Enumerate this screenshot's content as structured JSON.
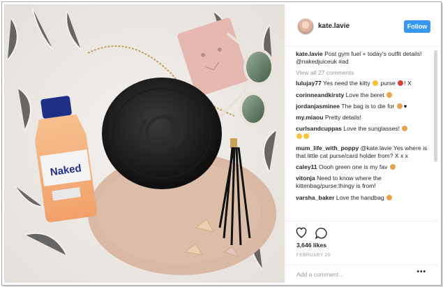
{
  "post": {
    "username": "kate.lavie",
    "follow_label": "Follow",
    "caption": {
      "user": "kate.lavie",
      "text": "Post gym fuel + today's outfit details! @nakedjuiceuk #ad"
    },
    "view_all_label": "View all 27 comments",
    "comments": [
      {
        "user": "lulujay77",
        "text": "Yes need the kitty",
        "trail": "purse",
        "end": "! X"
      },
      {
        "user": "corinneandkirsty",
        "text": "Love the beret",
        "trail": "",
        "end": ""
      },
      {
        "user": "jordanjasminee",
        "text": "The bag is to die for",
        "trail": "",
        "end": ""
      },
      {
        "user": "my.miaou",
        "text": "Pretty details!",
        "trail": "",
        "end": ""
      },
      {
        "user": "curlsandcuppas",
        "text": "Love the sunglasses!",
        "trail": "",
        "end": ""
      },
      {
        "user": "mum_life_with_poppy",
        "text": "@kate.lavie Yes where is that little cat purse/card holder from? X x x",
        "trail": "",
        "end": ""
      },
      {
        "user": "caley11",
        "text": "Oooh green one is my fav",
        "trail": "",
        "end": ""
      },
      {
        "user": "vitonja",
        "text": "Need to know where the kittenbag/purse:thingy is from!",
        "trail": "",
        "end": ""
      },
      {
        "user": "varsha_baker",
        "text": "Love the handbag",
        "trail": "",
        "end": ""
      }
    ],
    "likes": "3,646 likes",
    "date": "FEBRUARY 20",
    "add_comment_placeholder": "Add a comment...",
    "more_label": "•••"
  },
  "photo": {
    "bottle_brand": "Naked"
  },
  "icons": [
    "heart-icon",
    "comment-icon"
  ],
  "colors": {
    "accent": "#3897f0",
    "text": "#262626",
    "muted": "#999999"
  }
}
